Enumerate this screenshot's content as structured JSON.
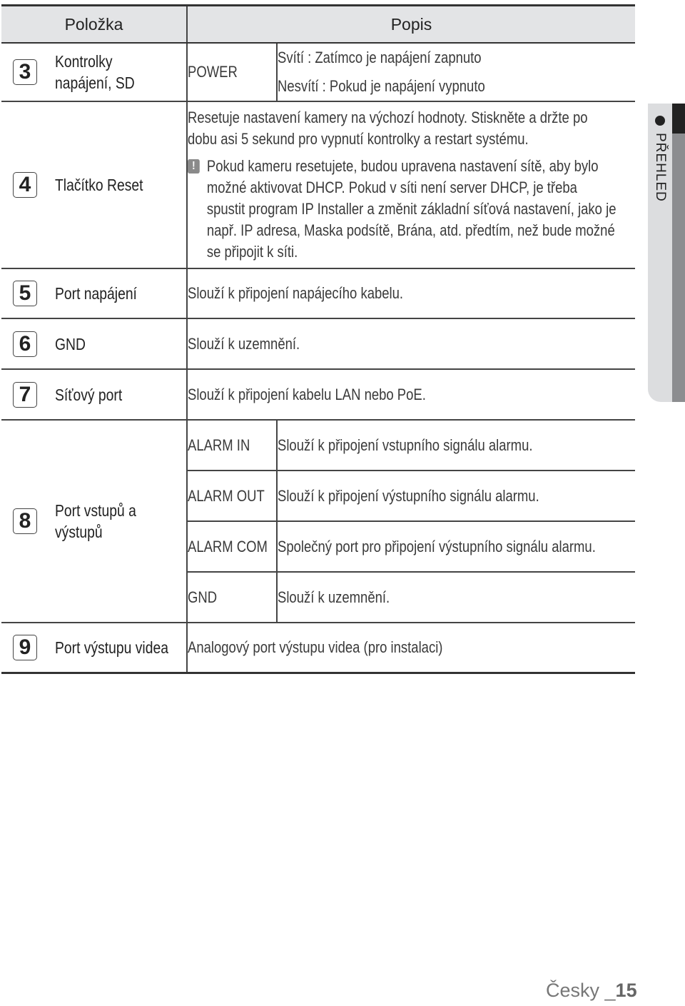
{
  "table": {
    "headers": {
      "item": "Položka",
      "description": "Popis"
    },
    "rows": [
      {
        "number": "3",
        "label": "Kontrolky napájení, SD",
        "sub": [
          {
            "name": "POWER",
            "lines": [
              "Svítí : Zatímco je napájení zapnuto",
              "Nesvítí : Pokud je napájení vypnuto"
            ]
          }
        ]
      },
      {
        "number": "4",
        "label": "Tlačítko Reset",
        "description": "Resetuje nastavení kamery na výchozí hodnoty. Stiskněte a držte po dobu asi 5 sekund pro vypnutí kontrolky a restart systému.",
        "note": "Pokud kameru resetujete, budou upravena nastavení sítě, aby bylo možné aktivovat DHCP. Pokud v síti není server DHCP, je třeba spustit program IP Installer a změnit základní síťová nastavení, jako je např. IP adresa, Maska podsítě, Brána, atd. předtím, než bude možné se připojit k síti.",
        "note_icon": "warning-icon"
      },
      {
        "number": "5",
        "label": "Port napájení",
        "description": "Slouží k připojení napájecího kabelu."
      },
      {
        "number": "6",
        "label": "GND",
        "description": "Slouží k uzemnění."
      },
      {
        "number": "7",
        "label": "Síťový port",
        "description": "Slouží k připojení kabelu LAN nebo PoE."
      },
      {
        "number": "8",
        "label": "Port vstupů a výstupů",
        "sub": [
          {
            "name": "ALARM IN",
            "description": "Slouží k připojení vstupního signálu alarmu."
          },
          {
            "name": "ALARM OUT",
            "description": "Slouží k připojení výstupního signálu alarmu."
          },
          {
            "name": "ALARM COM",
            "description": "Společný port pro připojení výstupního signálu alarmu."
          },
          {
            "name": "GND",
            "description": "Slouží k uzemnění."
          }
        ]
      },
      {
        "number": "9",
        "label": "Port výstupu videa",
        "description": "Analogový port výstupu videa (pro instalaci)"
      }
    ]
  },
  "side_tab": {
    "label": "PŘEHLED",
    "icon": "bullet-dot-icon"
  },
  "footer": {
    "language": "Česky _",
    "page": "15"
  }
}
